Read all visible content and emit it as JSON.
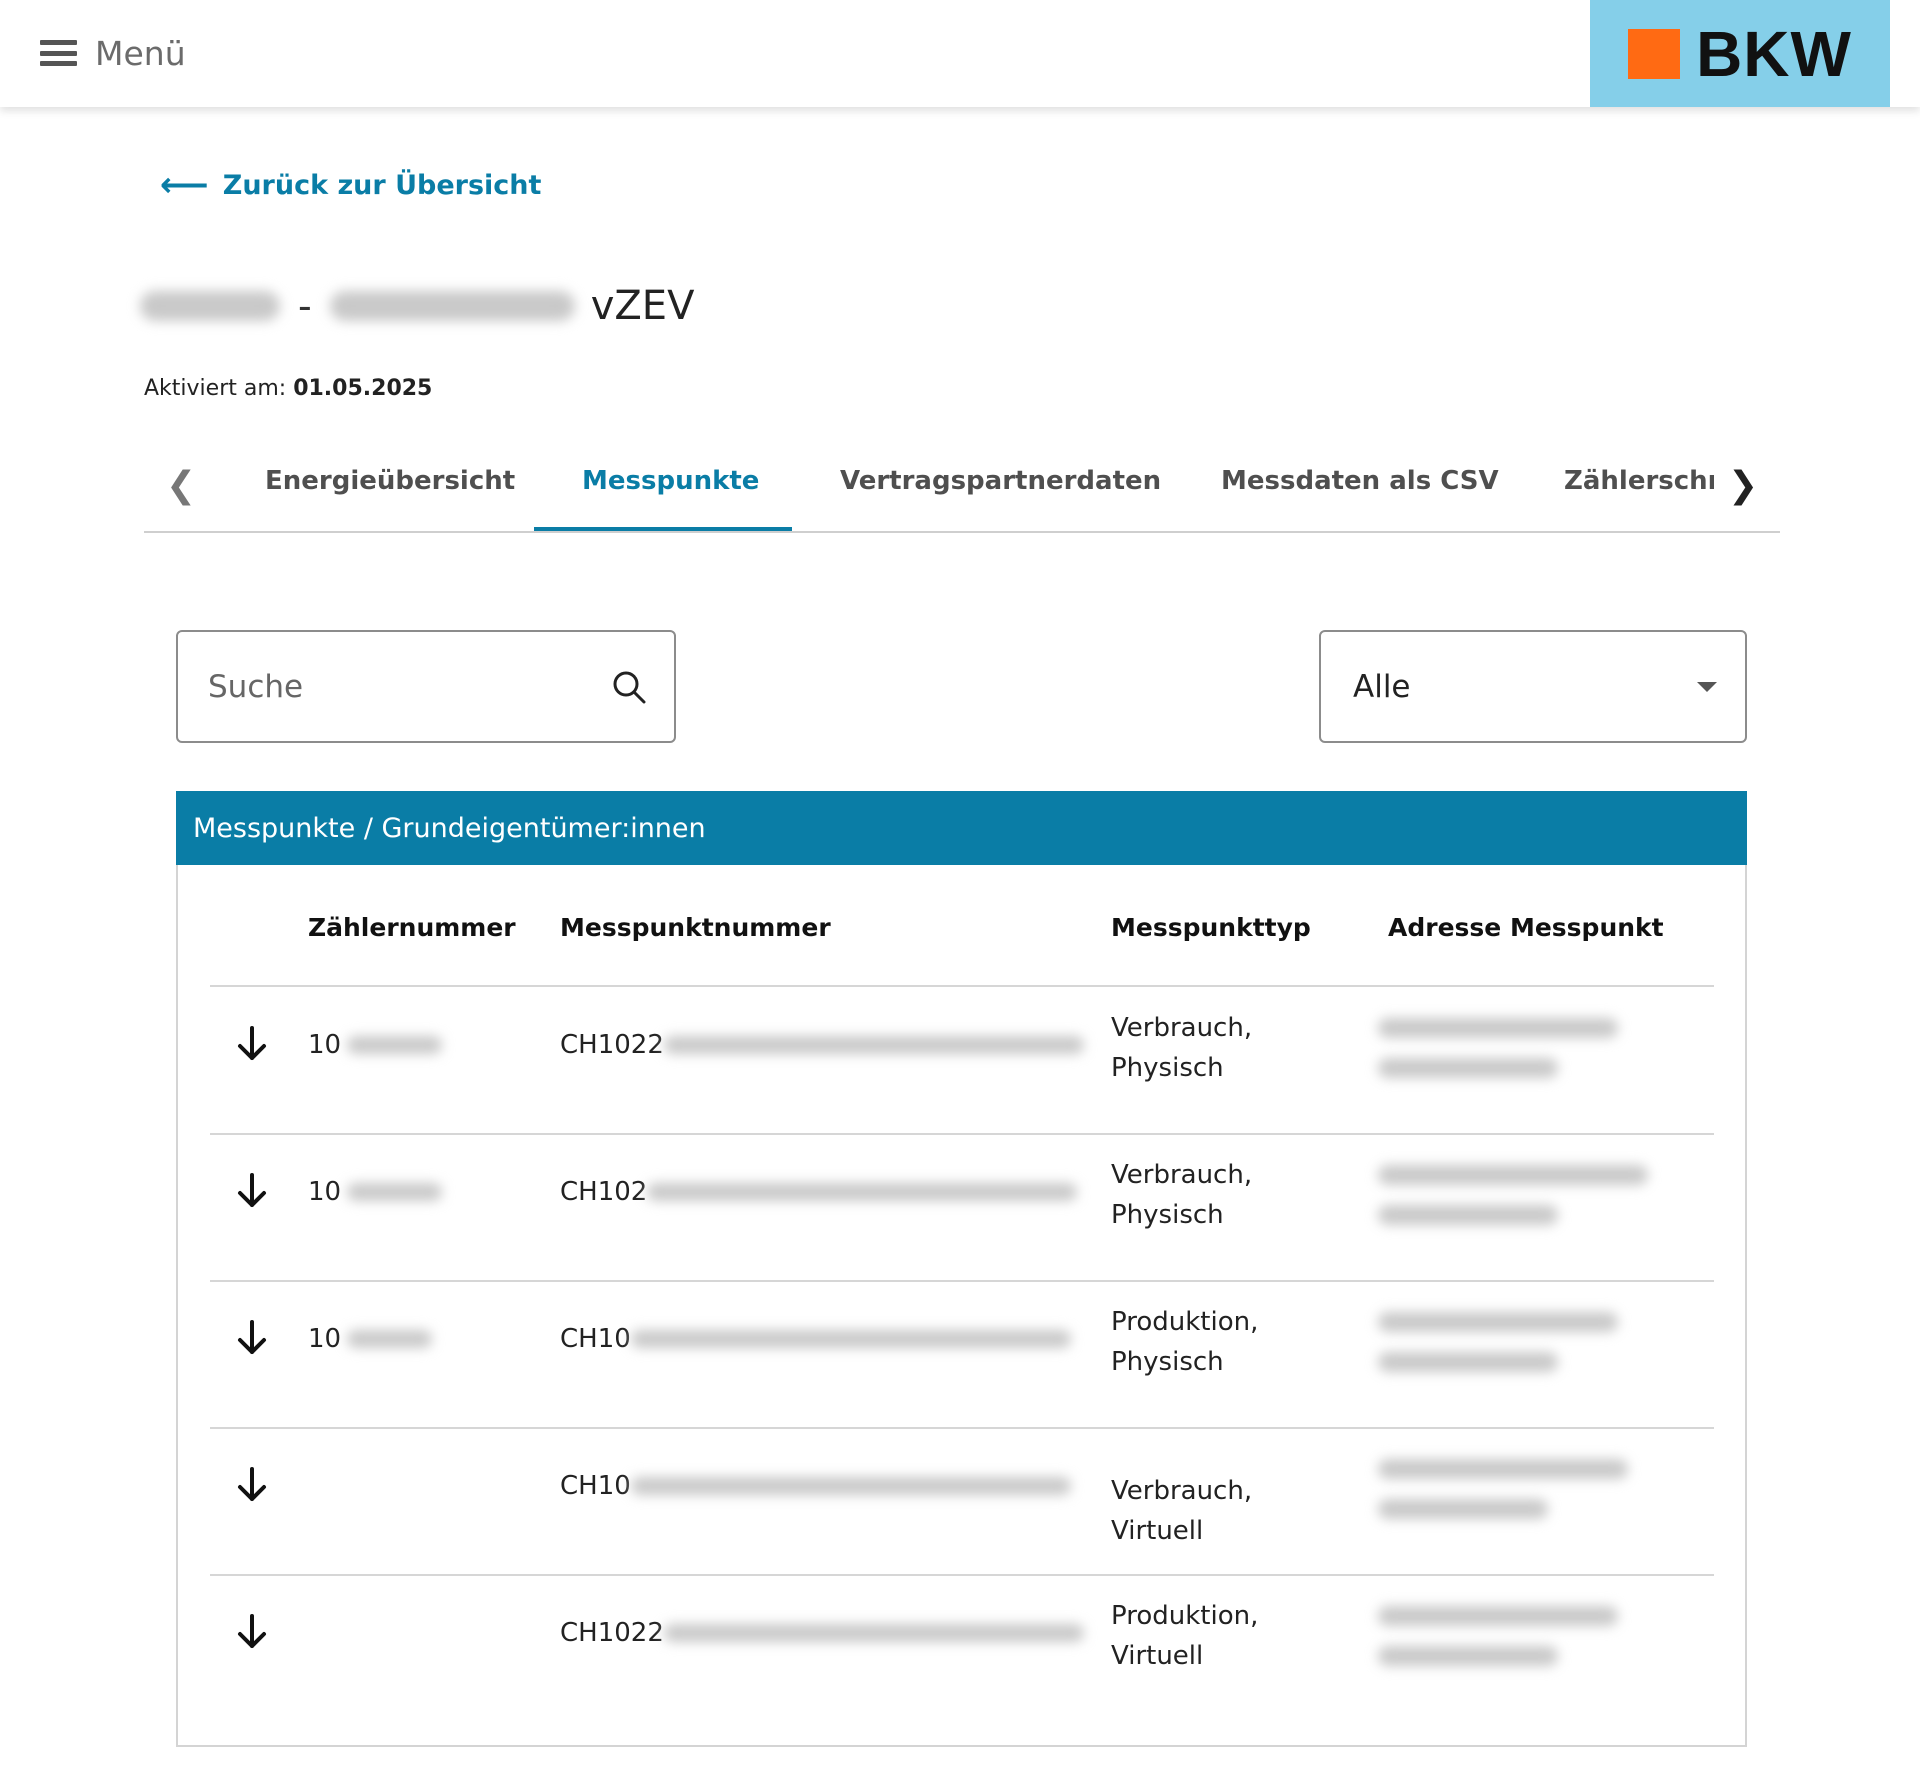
{
  "header": {
    "menu_label": "Menü",
    "logo_text": "BKW",
    "logo_colors": {
      "background": "#85cfe9",
      "square": "#ff6a13"
    }
  },
  "back_link": {
    "arrow": "⟵",
    "label": "Zurück zur Übersicht"
  },
  "title": {
    "separator": "-",
    "suffix": "vZEV"
  },
  "activated": {
    "label": "Aktiviert am:",
    "date": "01.05.2025"
  },
  "tabs": [
    {
      "label": "Energieübersicht",
      "active": false
    },
    {
      "label": "Messpunkte",
      "active": true
    },
    {
      "label": "Vertragspartnerdaten",
      "active": false
    },
    {
      "label": "Messdaten als CSV",
      "active": false
    },
    {
      "label": "Zählerschn",
      "active": false
    }
  ],
  "search": {
    "placeholder": "Suche"
  },
  "filter": {
    "selected": "Alle"
  },
  "panel": {
    "title": "Messpunkte / Grundeigentümer:innen",
    "columns": [
      "Zählernummer",
      "Messpunktnummer",
      "Messpunkttyp",
      "Adresse Messpunkt"
    ],
    "rows": [
      {
        "zaehlernummer": "10",
        "messpunktnummer": "CH1022",
        "typ_line1": "Verbrauch,",
        "typ_line2": "Physisch"
      },
      {
        "zaehlernummer": "10",
        "messpunktnummer": "CH102",
        "typ_line1": "Verbrauch,",
        "typ_line2": "Physisch"
      },
      {
        "zaehlernummer": "10",
        "messpunktnummer": "CH10",
        "typ_line1": "Produktion,",
        "typ_line2": "Physisch"
      },
      {
        "zaehlernummer": "",
        "messpunktnummer": "CH10",
        "typ_line1": "Verbrauch, Virtuell",
        "typ_line2": ""
      },
      {
        "zaehlernummer": "",
        "messpunktnummer": "CH1022",
        "typ_line1": "Produktion,",
        "typ_line2": "Virtuell"
      }
    ]
  },
  "colors": {
    "accent": "#0a7da6",
    "text": "#1a1a1a",
    "border": "#d6d6d6"
  }
}
